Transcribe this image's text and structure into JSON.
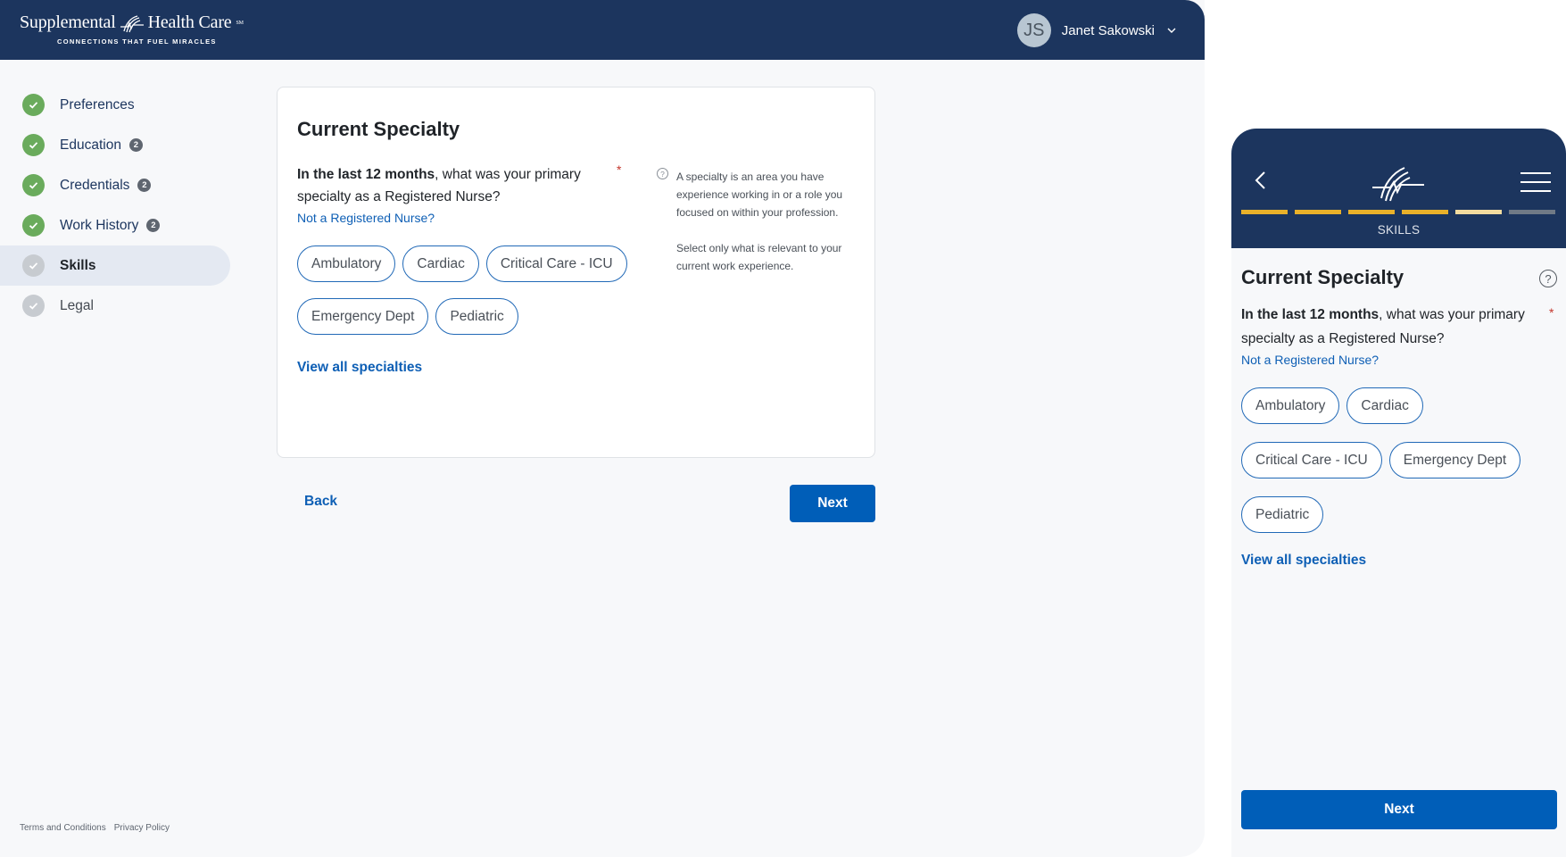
{
  "header": {
    "logo_name": "Supplemental",
    "logo_name_2": "Health Care",
    "logo_mark": "SM",
    "tagline": "CONNECTIONS THAT FUEL MIRACLES",
    "user": {
      "initials": "JS",
      "name": "Janet Sakowski"
    }
  },
  "sidebar": {
    "items": [
      {
        "label": "Preferences",
        "status": "complete",
        "badge": null
      },
      {
        "label": "Education",
        "status": "complete",
        "badge": "2"
      },
      {
        "label": "Credentials",
        "status": "complete",
        "badge": "2"
      },
      {
        "label": "Work History",
        "status": "complete",
        "badge": "2"
      },
      {
        "label": "Skills",
        "status": "current",
        "badge": null
      },
      {
        "label": "Legal",
        "status": "pending",
        "badge": null
      }
    ]
  },
  "form": {
    "title": "Current Specialty",
    "question_bold": "In the last 12 months",
    "question_rest": ", what was your primary specialty as a Registered Nurse?",
    "required_mark": "*",
    "not_rn_link": "Not a Registered Nurse?",
    "options": [
      "Ambulatory",
      "Cardiac",
      "Critical Care - ICU",
      "Emergency Dept",
      "Pediatric"
    ],
    "view_all": "View all specialties",
    "info_icon": "?",
    "info_p1": "A specialty is an area you have experience working in or a role you focused on within your profession.",
    "info_p2": "Select only what is relevant to your current work experience."
  },
  "actions": {
    "back": "Back",
    "next": "Next"
  },
  "footer": {
    "terms": "Terms and Conditions",
    "privacy": "Privacy Policy"
  },
  "mobile": {
    "step_label": "SKILLS",
    "progress": {
      "total_steps": 6,
      "completed": 4,
      "current_step": 5
    },
    "help_icon": "?",
    "options": [
      "Ambulatory",
      "Cardiac",
      "Critical Care - ICU",
      "Emergency Dept",
      "Pediatric"
    ],
    "next": "Next"
  },
  "colors": {
    "navy": "#1c355e",
    "primary_blue": "#005eb8",
    "link_blue": "#0e5fb5",
    "success_green": "#6aab5c",
    "progress_gold": "#e9b12a",
    "required_red": "#c4362c"
  }
}
